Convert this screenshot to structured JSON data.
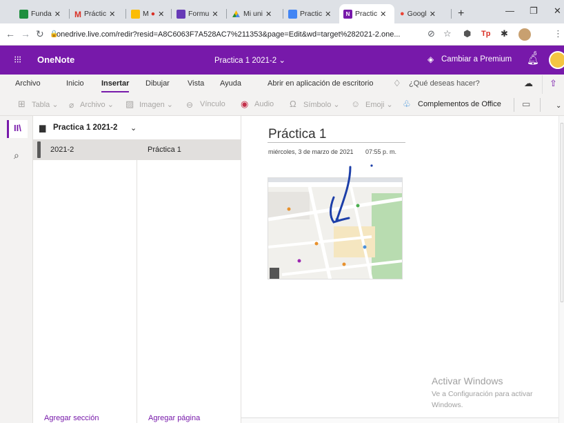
{
  "browser": {
    "tabs": [
      {
        "label": "Funda",
        "fav_color": "#1e8e3e",
        "fav_letter": "▤"
      },
      {
        "label": "Práctic",
        "fav_color": "#ffffff",
        "fav_letter": "M"
      },
      {
        "label": "M",
        "fav_color": "#fbbc04",
        "fav_letter": "▶"
      },
      {
        "label": "Formu",
        "fav_color": "#673ab7",
        "fav_letter": "☰"
      },
      {
        "label": "Mi uni",
        "fav_color": "#ffffff",
        "fav_letter": "▲"
      },
      {
        "label": "Practic",
        "fav_color": "#4285f4",
        "fav_letter": "☰"
      },
      {
        "label": "Practic",
        "fav_color": "#7719aa",
        "fav_letter": "N"
      },
      {
        "label": "Googl",
        "fav_color": "#ffffff",
        "fav_letter": "📍"
      }
    ],
    "new_tab": "+",
    "url": "onedrive.live.com/redir?resid=A8C6063F7A528AC7%211353&page=Edit&wd=target%282021-2.one..."
  },
  "onenote": {
    "app_name": "OneNote",
    "notebook_title": "Practica 1 2021-2 ⌄",
    "premium": "Cambiar a Premium",
    "notif_count": "6"
  },
  "ribbon": {
    "tabs": [
      "Archivo",
      "Inicio",
      "Insertar",
      "Dibujar",
      "Vista",
      "Ayuda"
    ],
    "open_desktop": "Abrir en aplicación de escritorio",
    "search_placeholder": "¿Qué deseas hacer?"
  },
  "toolbar": {
    "tabla": "Tabla ⌄",
    "archivo": "Archivo ⌄",
    "imagen": "Imagen ⌄",
    "vinculo": "Vínculo",
    "audio": "Audio",
    "simbolo": "Símbolo ⌄",
    "emoji": "Emoji ⌄",
    "complementos": "Complementos de Office"
  },
  "nav": {
    "notebook": "Practica 1 2021-2",
    "section": "2021-2",
    "page": "Práctica 1",
    "add_section": "Agregar sección",
    "add_page": "Agregar página"
  },
  "page": {
    "title": "Práctica 1",
    "date": "miércoles, 3 de marzo de 2021",
    "time": "07:55 p. m."
  },
  "watermark": {
    "line1": "Activar Windows",
    "line2": "Ve a Configuración para activar",
    "line3": "Windows."
  }
}
